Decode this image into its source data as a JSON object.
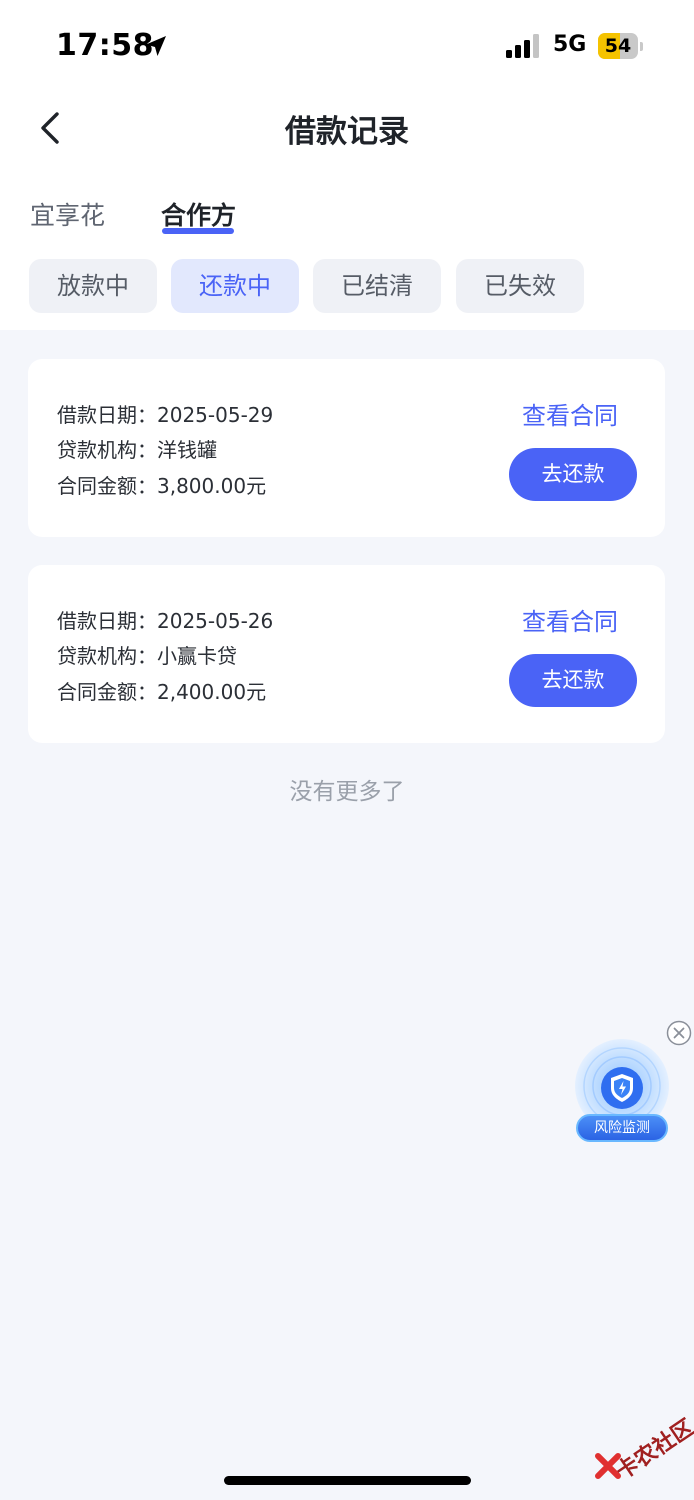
{
  "status_bar": {
    "time": "17:58",
    "network": "5G",
    "battery": "54",
    "battery_level": 0.54
  },
  "header": {
    "title": "借款记录",
    "back_icon": "chevron-left-icon"
  },
  "tabs": [
    {
      "label": "宜享花",
      "active": false
    },
    {
      "label": "合作方",
      "active": true
    }
  ],
  "filters": [
    {
      "label": "放款中",
      "active": false
    },
    {
      "label": "还款中",
      "active": true
    },
    {
      "label": "已结清",
      "active": false
    },
    {
      "label": "已失效",
      "active": false
    }
  ],
  "records": [
    {
      "date_label": "借款日期：",
      "date": "2025-05-29",
      "lender_label": "贷款机构：",
      "lender": "洋钱罐",
      "amount_label": "合同金额：",
      "amount": "3,800.00元",
      "contract_link": "查看合同",
      "repay_label": "去还款"
    },
    {
      "date_label": "借款日期：",
      "date": "2025-05-26",
      "lender_label": "贷款机构：",
      "lender": "小赢卡贷",
      "amount_label": "合同金额：",
      "amount": "2,400.00元",
      "contract_link": "查看合同",
      "repay_label": "去还款"
    }
  ],
  "no_more_text": "没有更多了",
  "risk_widget": {
    "label": "风险监测",
    "icon": "shield-icon",
    "close_icon": "close-icon"
  },
  "watermark": {
    "text": "卡农社区"
  },
  "colors": {
    "accent": "#4a63f6",
    "background": "#f4f6fb",
    "chip_active_bg": "#e2e8fd"
  }
}
